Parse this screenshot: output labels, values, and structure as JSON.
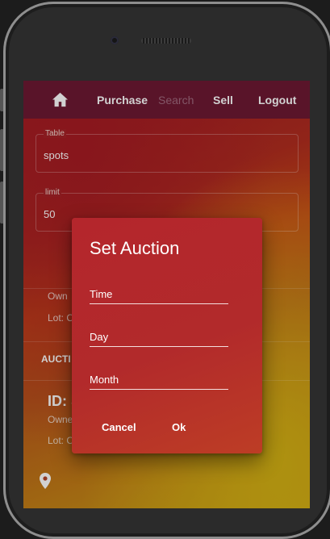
{
  "nav": {
    "home_icon": "home-icon",
    "purchase": "Purchase",
    "search": "Search",
    "sell": "Sell",
    "logout": "Logout"
  },
  "form": {
    "table_label": "Table",
    "table_value": "spots",
    "limit_label": "limit",
    "limit_value": "50"
  },
  "background": {
    "owner_1": "Own",
    "lot_1": "Lot: C",
    "auction_header": "AUCTI",
    "id_2": "ID: S",
    "owner_2": "Owne",
    "lot_2": "Lot: C",
    "location_icon": "location-pin-icon"
  },
  "dialog": {
    "title": "Set Auction",
    "time_placeholder": "Time",
    "day_placeholder": "Day",
    "month_placeholder": "Month",
    "cancel": "Cancel",
    "ok": "Ok"
  },
  "colors": {
    "topbar": "#6d1933",
    "dialog": "#b4262c",
    "accent_yellow": "#cba313"
  }
}
